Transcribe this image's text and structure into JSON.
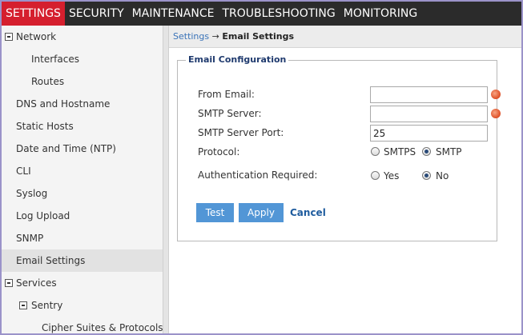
{
  "topnav": {
    "tabs": [
      {
        "label": "SETTINGS",
        "active": true
      },
      {
        "label": "SECURITY"
      },
      {
        "label": "MAINTENANCE"
      },
      {
        "label": "TROUBLESHOOTING"
      },
      {
        "label": "MONITORING"
      }
    ]
  },
  "sidebar": {
    "items": [
      {
        "label": "Network"
      },
      {
        "label": "Interfaces"
      },
      {
        "label": "Routes"
      },
      {
        "label": "DNS and Hostname"
      },
      {
        "label": "Static Hosts"
      },
      {
        "label": "Date and Time (NTP)"
      },
      {
        "label": "CLI"
      },
      {
        "label": "Syslog"
      },
      {
        "label": "Log Upload"
      },
      {
        "label": "SNMP"
      },
      {
        "label": "Email Settings",
        "active": true
      },
      {
        "label": "Services"
      },
      {
        "label": "Sentry"
      },
      {
        "label": "Cipher Suites & Protocols"
      }
    ]
  },
  "breadcrumb": {
    "parent": "Settings",
    "arrow": "→",
    "current": "Email Settings"
  },
  "form": {
    "legend": "Email Configuration",
    "from_email": {
      "label": "From Email:",
      "value": "",
      "required": true
    },
    "smtp_server": {
      "label": "SMTP Server:",
      "value": "",
      "required": true
    },
    "smtp_port": {
      "label": "SMTP Server Port:",
      "value": "25"
    },
    "protocol": {
      "label": "Protocol:",
      "options": [
        "SMTPS",
        "SMTP"
      ],
      "selected": "SMTP"
    },
    "auth": {
      "label": "Authentication Required:",
      "options": [
        "Yes",
        "No"
      ],
      "selected": "No"
    },
    "buttons": {
      "test": "Test",
      "apply": "Apply",
      "cancel": "Cancel"
    }
  },
  "colors": {
    "active_tab": "#d51f2e",
    "topnav_bg": "#2b2b2b",
    "button": "#5296d6",
    "link": "#3a73b8"
  }
}
